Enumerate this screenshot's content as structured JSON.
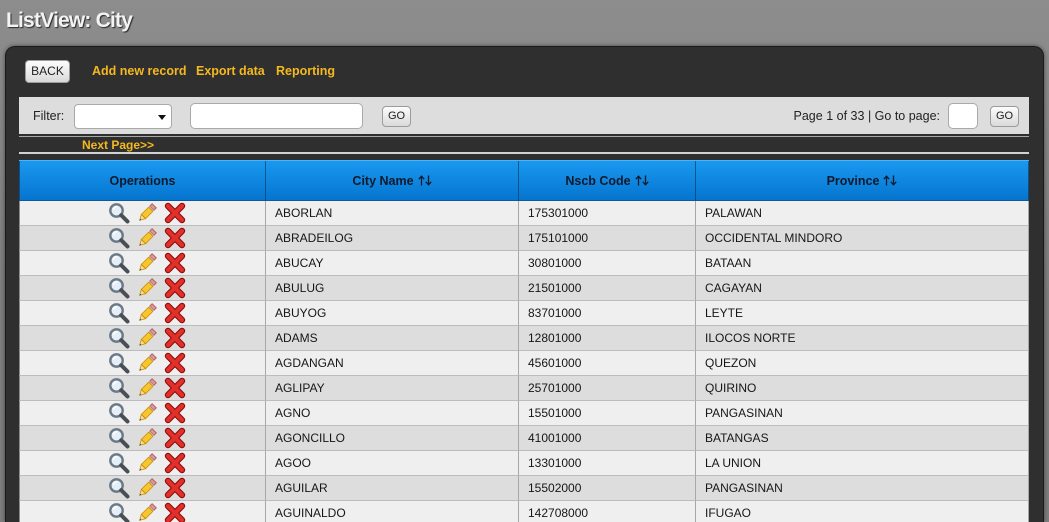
{
  "page": {
    "title": "ListView: City"
  },
  "colors": {
    "background": "#7e7e7e",
    "panel": "#2f2f2f",
    "link": "#f5b91f",
    "filter_bar": "#dddddd",
    "header_top": "#1a98ef",
    "header_bottom": "#0574cf",
    "row_light": "#efefef",
    "row_dark": "#dddddd"
  },
  "toolbar": {
    "back_label": "BACK",
    "links": [
      {
        "label": "Add new record"
      },
      {
        "label": "Export data"
      },
      {
        "label": "Reporting"
      }
    ]
  },
  "filter": {
    "label": "Filter:",
    "field_value": "",
    "select_icon": "chevron-down-icon",
    "search_value": "",
    "go_label": "GO"
  },
  "pagination": {
    "page_label": "Page",
    "current_page": 1,
    "of_label": "of",
    "total_pages": 33,
    "separator": "|",
    "goto_label": "Go to page:",
    "goto_value": "",
    "go_label": "GO",
    "next_label": "Next Page>>"
  },
  "table": {
    "sort_icon": "sort-arrows-icon",
    "row_action_icons": [
      "magnifier-icon",
      "pencil-icon",
      "delete-icon"
    ],
    "columns": [
      {
        "label": "Operations",
        "sortable": false
      },
      {
        "label": "City Name",
        "sortable": true
      },
      {
        "label": "Nscb Code",
        "sortable": true
      },
      {
        "label": "Province",
        "sortable": true
      }
    ],
    "rows": [
      [
        "ABORLAN",
        "175301000",
        "PALAWAN"
      ],
      [
        "ABRADEILOG",
        "175101000",
        "OCCIDENTAL MINDORO"
      ],
      [
        "ABUCAY",
        "30801000",
        "BATAAN"
      ],
      [
        "ABULUG",
        "21501000",
        "CAGAYAN"
      ],
      [
        "ABUYOG",
        "83701000",
        "LEYTE"
      ],
      [
        "ADAMS",
        "12801000",
        "ILOCOS NORTE"
      ],
      [
        "AGDANGAN",
        "45601000",
        "QUEZON"
      ],
      [
        "AGLIPAY",
        "25701000",
        "QUIRINO"
      ],
      [
        "AGNO",
        "15501000",
        "PANGASINAN"
      ],
      [
        "AGONCILLO",
        "41001000",
        "BATANGAS"
      ],
      [
        "AGOO",
        "13301000",
        "LA UNION"
      ],
      [
        "AGUILAR",
        "15502000",
        "PANGASINAN"
      ],
      [
        "AGUINALDO",
        "142708000",
        "IFUGAO"
      ]
    ]
  }
}
